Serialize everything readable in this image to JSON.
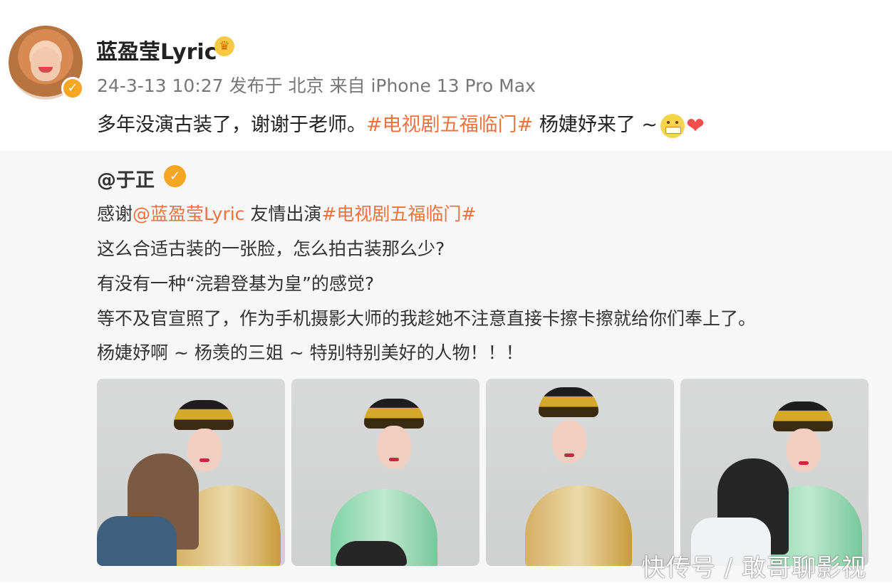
{
  "post": {
    "author": "蓝盈莹Lyric",
    "timestamp": "24-3-13 10:27",
    "published_label": "发布于",
    "location": "北京",
    "source_label": "来自",
    "device": "iPhone 13 Pro Max",
    "text_before": "多年没演古装了，谢谢于老师。",
    "hashtag": "#电视剧五福临门#",
    "text_after": " 杨婕妤来了 ~",
    "badge_icon": "verified-badge-icon",
    "crown_icon": "crown-icon"
  },
  "repost": {
    "author": "@于正",
    "line1_prefix": "感谢",
    "mention": "@蓝盈莹Lyric",
    "line1_middle": " 友情出演",
    "hashtag": "#电视剧五福临门#",
    "line2": "这么合适古装的一张脸，怎么拍古装那么少?",
    "line3": "有没有一种“浣碧登基为皇”的感觉?",
    "line4": "等不及官宣照了，作为手机摄影大师的我趁她不注意直接卡擦卡擦就给你们奉上了。",
    "line5": "杨婕妤啊 ~ 杨羡的三姐 ~ 特别特别美好的人物！！！"
  },
  "watermark": "快传号 / 敢哥聊影视",
  "colors": {
    "hashtag": "#eb7340",
    "background": "#f7f7f7",
    "text": "#222222"
  }
}
